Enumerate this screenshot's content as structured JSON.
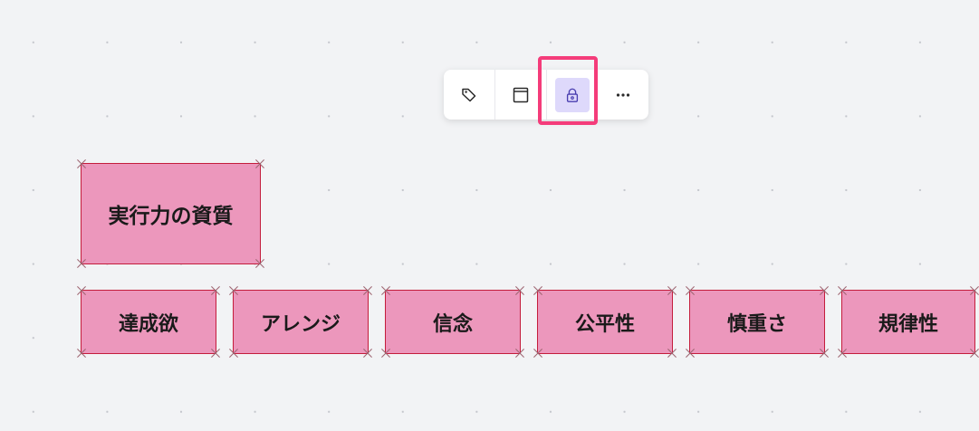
{
  "toolbar": {
    "buttons": [
      {
        "name": "tag",
        "icon": "tag-icon"
      },
      {
        "name": "frame",
        "icon": "frame-icon"
      },
      {
        "name": "lock",
        "icon": "lock-icon",
        "active": true
      },
      {
        "name": "more",
        "icon": "more-icon"
      }
    ]
  },
  "colors": {
    "sticky_fill": "#ec97bc",
    "sticky_border": "#c41d3c",
    "highlight": "#f43c7a",
    "lock_active_bg": "#ded9fb"
  },
  "stickies": {
    "header": "実行力の資質",
    "items": [
      "達成欲",
      "アレンジ",
      "信念",
      "公平性",
      "慎重さ",
      "規律性"
    ]
  }
}
